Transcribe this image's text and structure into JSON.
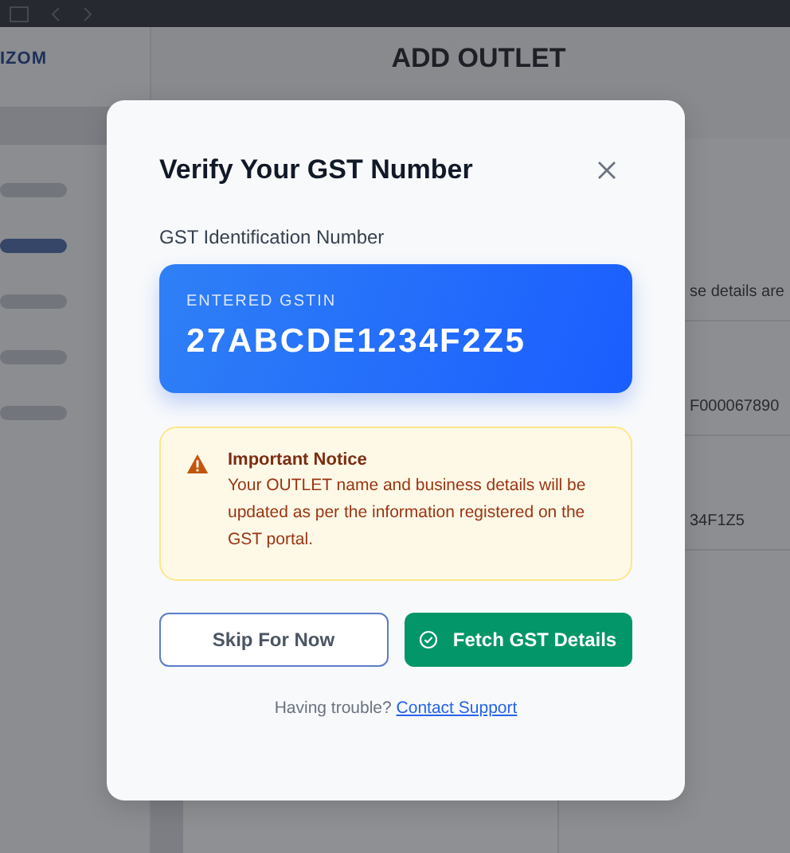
{
  "background": {
    "logo": "IZOM",
    "title": "ADD OUTLET",
    "sidebar": {
      "items": [
        {
          "selected": false
        },
        {
          "selected": true
        },
        {
          "selected": false
        },
        {
          "selected": false
        },
        {
          "selected": false
        }
      ]
    },
    "details": [
      "se details are",
      "F000067890",
      "34F1Z5"
    ]
  },
  "dialog": {
    "title": "Verify Your GST Number",
    "field_label": "GST Identification Number",
    "gstin_card": {
      "caption": "ENTERED GSTIN",
      "value": "27ABCDE1234F2Z5"
    },
    "notice": {
      "title": "Important Notice",
      "text": "Your OUTLET name and business details will be updated as per the information registered on the GST portal."
    },
    "buttons": [
      {
        "kind": "secondary",
        "label": "Skip For Now"
      },
      {
        "kind": "primary",
        "label": "Fetch GST Details"
      }
    ],
    "footer": {
      "text": "Having trouble?",
      "link": "Contact Support"
    }
  }
}
